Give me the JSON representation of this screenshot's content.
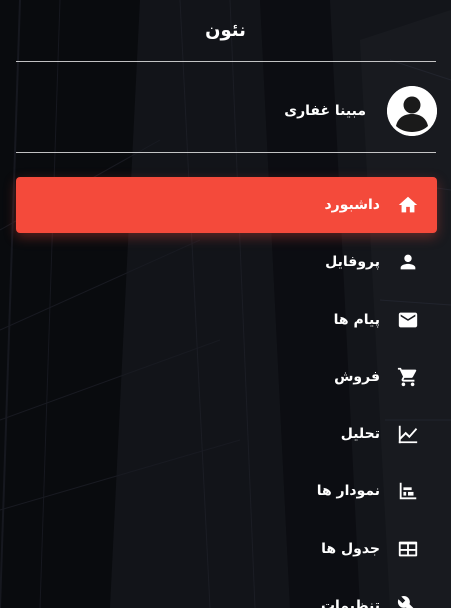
{
  "sidebar": {
    "brand": "نئون",
    "user": {
      "name": "مبینا غفاری",
      "avatar_icon": "account-circle-icon"
    },
    "accent_color": "#f44a3b",
    "items": [
      {
        "label": "داشبورد",
        "icon": "home-icon",
        "active": true
      },
      {
        "label": "پروفایل",
        "icon": "person-icon",
        "active": false
      },
      {
        "label": "پیام ها",
        "icon": "mail-icon",
        "active": false
      },
      {
        "label": "فروش",
        "icon": "shopping-cart-icon",
        "active": false
      },
      {
        "label": "تحلیل",
        "icon": "trending-chart-icon",
        "active": false
      },
      {
        "label": "نمودار ها",
        "icon": "bar-chart-icon",
        "active": false
      },
      {
        "label": "جدول ها",
        "icon": "table-icon",
        "active": false
      },
      {
        "label": "تنظیمات",
        "icon": "wrench-icon",
        "active": false
      }
    ]
  }
}
